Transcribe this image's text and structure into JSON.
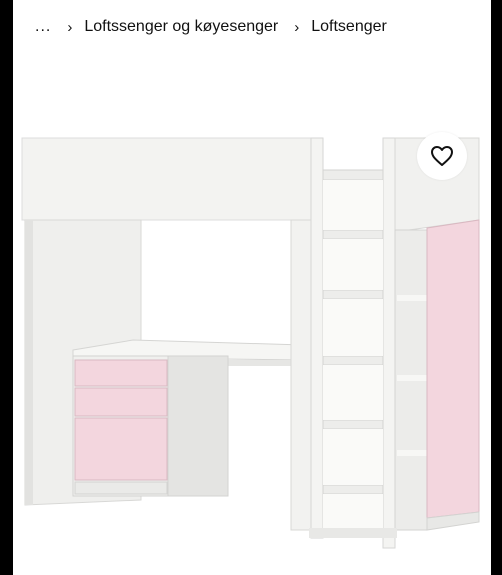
{
  "breadcrumb": {
    "ellipsis": "...",
    "separator": "›",
    "items": [
      "Loftssenger og køyesenger",
      "Loftsenger"
    ]
  },
  "product_image": {
    "subject": "white loft bed with desk, shelves and light pink drawers and wardrobe door",
    "colors": {
      "frame": "#f4f4f2",
      "accent_pink": "#f3d6de"
    }
  },
  "favourite": {
    "icon": "heart-outline-icon"
  }
}
